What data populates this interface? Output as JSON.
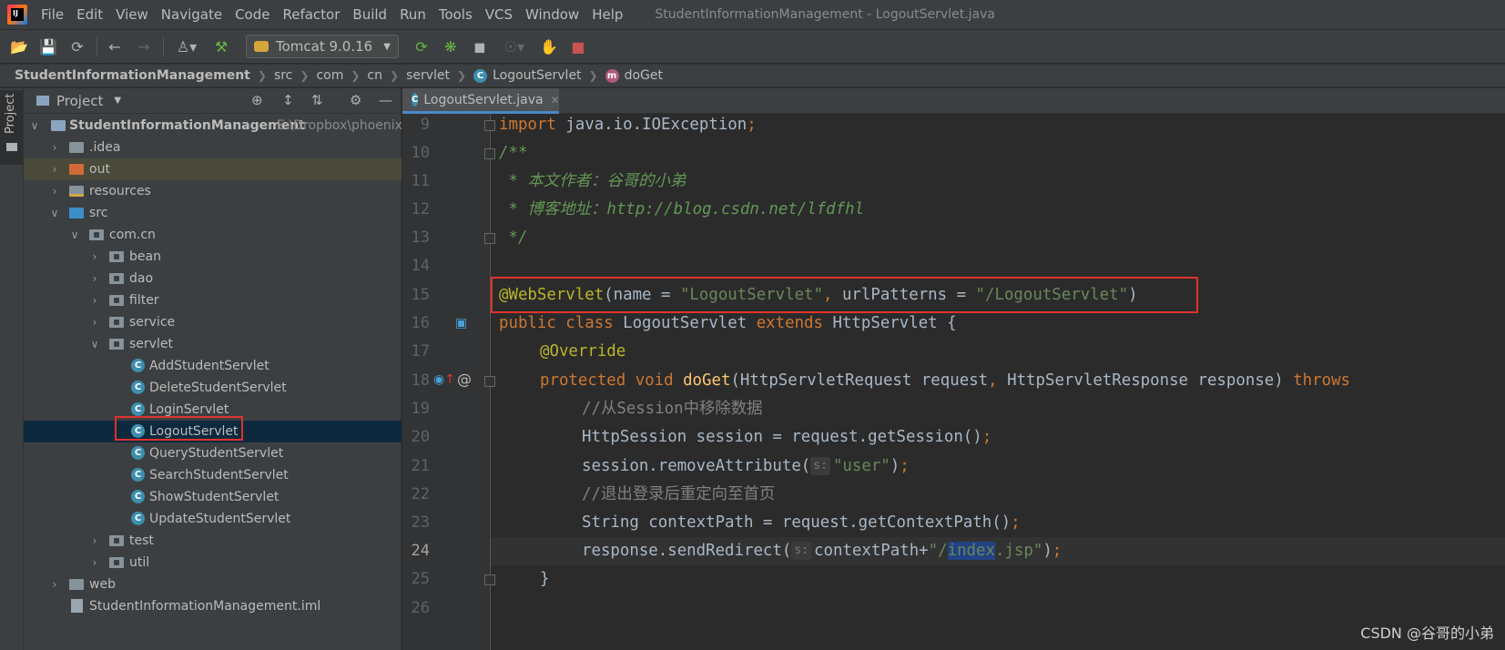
{
  "app": {
    "logo_text": "IJ",
    "menu": [
      "File",
      "Edit",
      "View",
      "Navigate",
      "Code",
      "Refactor",
      "Build",
      "Run",
      "Tools",
      "VCS",
      "Window",
      "Help"
    ],
    "window_title": "StudentInformationManagement - LogoutServlet.java"
  },
  "toolbar": {
    "run_config": "Tomcat 9.0.16"
  },
  "breadcrumb": [
    "StudentInformationManagement",
    "src",
    "com",
    "cn",
    "servlet",
    "LogoutServlet",
    "doGet"
  ],
  "sidebar": {
    "tab_label": "Project"
  },
  "project_panel": {
    "title": "Project",
    "root_name": "StudentInformationManagement",
    "root_path": "E:\\Dropbox\\phoenix\\",
    "items": {
      "idea": ".idea",
      "out": "out",
      "resources": "resources",
      "src": "src",
      "comcn": "com.cn",
      "bean": "bean",
      "dao": "dao",
      "filter": "filter",
      "service": "service",
      "servlet": "servlet",
      "c1": "AddStudentServlet",
      "c2": "DeleteStudentServlet",
      "c3": "LoginServlet",
      "c4": "LogoutServlet",
      "c5": "QueryStudentServlet",
      "c6": "SearchStudentServlet",
      "c7": "ShowStudentServlet",
      "c8": "UpdateStudentServlet",
      "test": "test",
      "util": "util",
      "web": "web",
      "iml": "StudentInformationManagement.iml"
    }
  },
  "editor_tab": {
    "label": "LogoutServlet.java"
  },
  "code": {
    "line_numbers": [
      "9",
      "10",
      "11",
      "12",
      "13",
      "14",
      "15",
      "16",
      "17",
      "18",
      "19",
      "20",
      "21",
      "22",
      "23",
      "24",
      "25",
      "26"
    ],
    "l9_kw": "import",
    "l9_rest": " java.io.IOException",
    "l10": "/**",
    "l11": " * 本文作者：谷哥的小弟",
    "l12": " * 博客地址：http://blog.csdn.net/lfdfhl",
    "l13": " */",
    "l15_ann": "@WebServlet",
    "l15_a": "(name = ",
    "l15_s1": "\"LogoutServlet\"",
    "l15_comma": ", ",
    "l15_b": "urlPatterns = ",
    "l15_s2": "\"/LogoutServlet\"",
    "l15_end": ")",
    "l16_kw1": "public class",
    "l16_name": " LogoutServlet ",
    "l16_kw2": "extends",
    "l16_rest": " HttpServlet {",
    "l17": "@Override",
    "l18_kw": "protected void",
    "l18_fn": "doGet",
    "l18_a": "(HttpServletRequest request",
    "l18_b": " HttpServletResponse response) ",
    "l18_kw2": "throws",
    "l19": "//从Session中移除数据",
    "l20": "HttpSession session = request.getSession()",
    "l21_a": "session.removeAttribute(",
    "l21_hint": "s:",
    "l21_str": "\"user\"",
    "l21_end": ")",
    "l22": "//退出登录后重定向至首页",
    "l23": "String contextPath = request.getContextPath()",
    "l24_a": "response.sendRedirect(",
    "l24_hint": "s:",
    "l24_b": "contextPath+",
    "l24_s1": "\"/",
    "l24_sel": "index",
    "l24_s2": ".jsp\"",
    "l24_end": ")",
    "l25": "}",
    "semicolon": ";",
    "comma": ","
  },
  "watermark": "CSDN @谷哥的小弟"
}
